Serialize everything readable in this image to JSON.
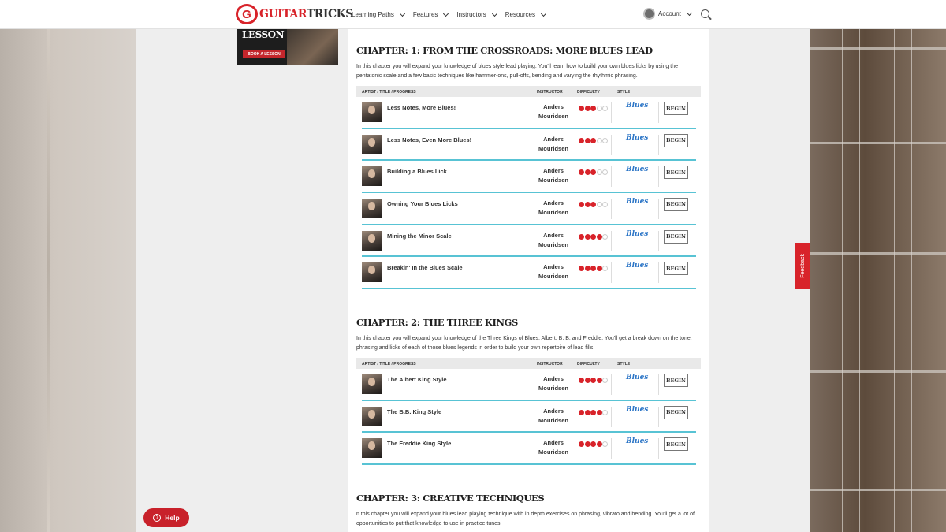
{
  "header": {
    "logo_text": "GUITAR",
    "logo_text2": "TRICKS",
    "nav": [
      "Learning Paths",
      "Features",
      "Instructors",
      "Resources"
    ],
    "account_label": "Account"
  },
  "sidebar_ad": {
    "title": "LESSON",
    "button": "BOOK A LESSON"
  },
  "table_head": {
    "col1": "ARTIST / TITLE / PROGRESS",
    "col2": "INSTRUCTOR",
    "col3": "DIFFICULTY",
    "col4": "STYLE"
  },
  "chapters": [
    {
      "title": "Chapter: 1: From The Crossroads: More Blues Lead",
      "desc": "In this chapter you will expand your knowledge of blues style lead playing. You'll learn how to build your own blues licks by using the pentatonic scale and a few basic techniques like hammer-ons, pull-offs, bending and varying the rhythmic phrasing.",
      "lessons": [
        {
          "title": "Less Notes, More Blues!",
          "instructor1": "Anders",
          "instructor2": "Mouridsen",
          "difficulty": 3,
          "style": "Blues",
          "button": "BEGIN"
        },
        {
          "title": "Less Notes, Even More Blues!",
          "instructor1": "Anders",
          "instructor2": "Mouridsen",
          "difficulty": 3,
          "style": "Blues",
          "button": "BEGIN"
        },
        {
          "title": "Building a Blues Lick",
          "instructor1": "Anders",
          "instructor2": "Mouridsen",
          "difficulty": 3,
          "style": "Blues",
          "button": "BEGIN"
        },
        {
          "title": "Owning Your Blues Licks",
          "instructor1": "Anders",
          "instructor2": "Mouridsen",
          "difficulty": 3,
          "style": "Blues",
          "button": "BEGIN"
        },
        {
          "title": "Mining the Minor Scale",
          "instructor1": "Anders",
          "instructor2": "Mouridsen",
          "difficulty": 4,
          "style": "Blues",
          "button": "BEGIN"
        },
        {
          "title": "Breakin' In the Blues Scale",
          "instructor1": "Anders",
          "instructor2": "Mouridsen",
          "difficulty": 4,
          "style": "Blues",
          "button": "BEGIN"
        }
      ]
    },
    {
      "title": "Chapter: 2: The Three Kings",
      "desc": "In this chapter you will expand your knowledge of the Three Kings of Blues: Albert, B. B. and Freddie. You'll get a break down on the tone, phrasing and licks of each of those blues legends in order to build your own repertoire of lead fills.",
      "lessons": [
        {
          "title": "The Albert King Style",
          "instructor1": "Anders",
          "instructor2": "Mouridsen",
          "difficulty": 4,
          "style": "Blues",
          "button": "BEGIN"
        },
        {
          "title": "The B.B. King Style",
          "instructor1": "Anders",
          "instructor2": "Mouridsen",
          "difficulty": 4,
          "style": "Blues",
          "button": "BEGIN"
        },
        {
          "title": "The Freddie King Style",
          "instructor1": "Anders",
          "instructor2": "Mouridsen",
          "difficulty": 4,
          "style": "Blues",
          "button": "BEGIN"
        }
      ]
    },
    {
      "title": "Chapter: 3: Creative Techniques",
      "desc": "n this chapter you will expand your blues lead playing technique with in depth exercises on phrasing, vibrato and bending. You'll get a lot of opportunities to put that knowledge to use in practice tunes!",
      "lessons": []
    }
  ],
  "feedback_label": "Feedback",
  "help_label": "Help",
  "colors": {
    "brand": "#d8232a",
    "accent": "#58c3d4",
    "style": "#2a74c6"
  }
}
